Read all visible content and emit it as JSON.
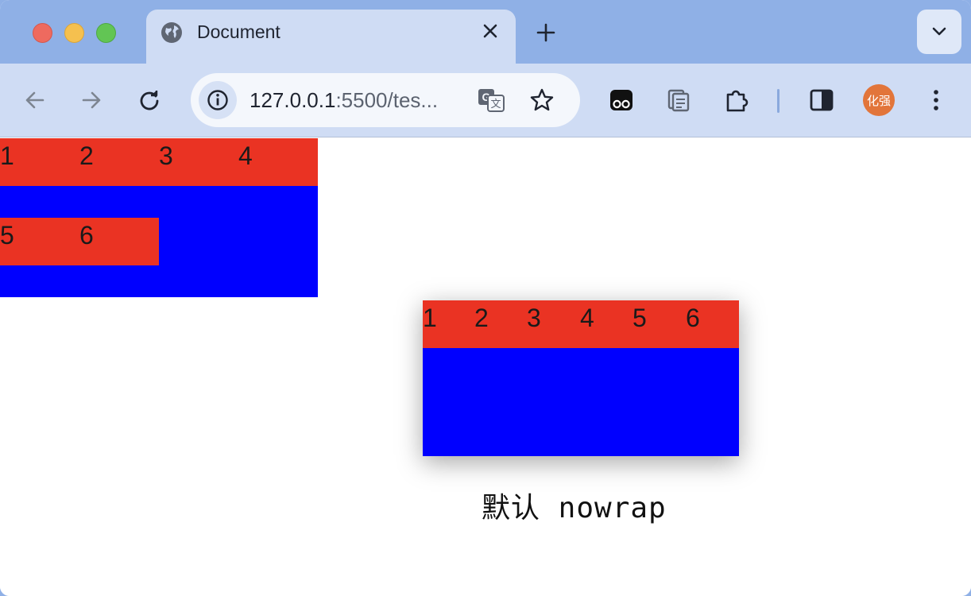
{
  "window": {
    "tab": {
      "title": "Document",
      "icon": "globe-icon"
    },
    "toolbar": {
      "url_host": "127.0.0.1",
      "url_rest": ":5500/tes...",
      "profile_label": "化强"
    }
  },
  "page": {
    "wrap_demo": {
      "row1": [
        "1",
        "2",
        "3",
        "4"
      ],
      "row2": [
        "5",
        "6"
      ]
    },
    "nowrap_demo": {
      "items": [
        "1",
        "2",
        "3",
        "4",
        "5",
        "6"
      ]
    },
    "caption": "默认 nowrap"
  },
  "colors": {
    "item_bg": "#ea3323",
    "container_bg": "#0000ff",
    "tabstrip": "#8fb0e6",
    "toolbar": "#cfdcf4",
    "profile": "#e2753a"
  }
}
